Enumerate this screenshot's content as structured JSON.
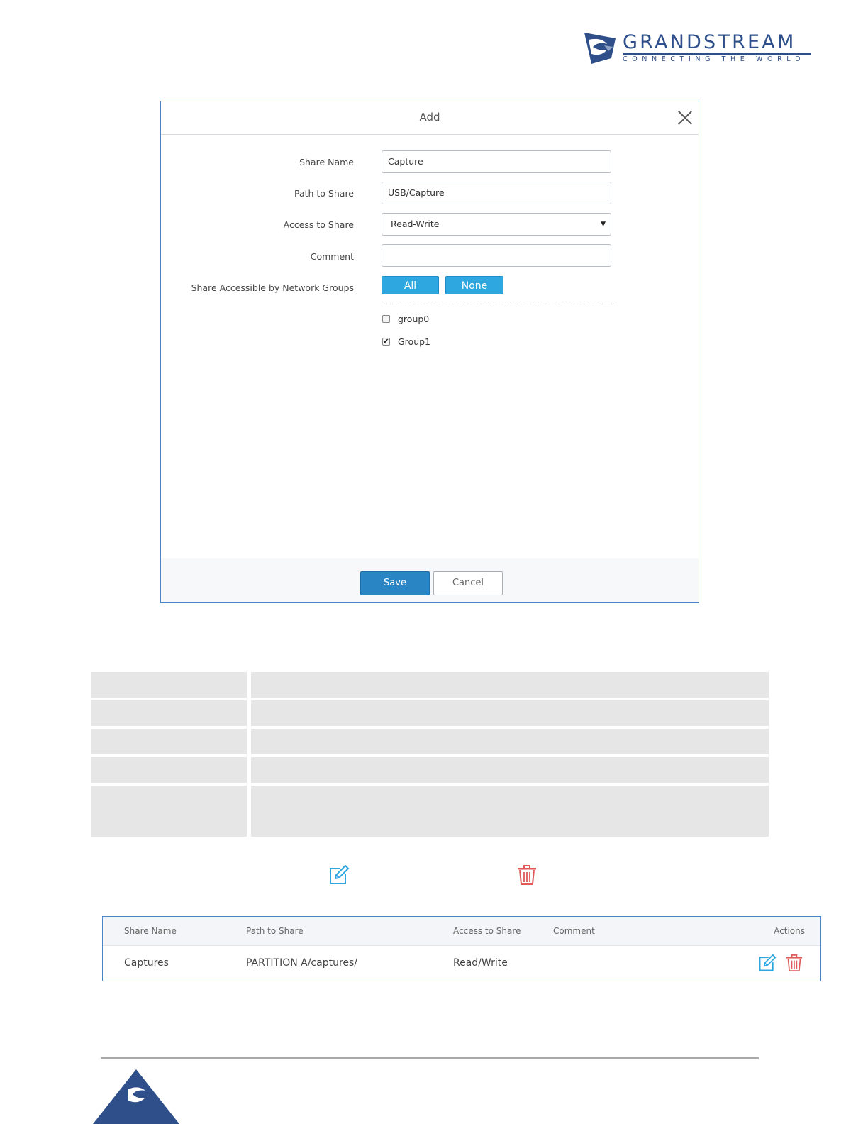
{
  "logo": {
    "brand": "GRANDSTREAM",
    "tagline": "CONNECTING THE WORLD",
    "brand_color": "#2f4f8a"
  },
  "dialog": {
    "title": "Add",
    "close_icon": "close-icon",
    "fields": {
      "share_name": {
        "label": "Share Name",
        "value": "Capture"
      },
      "path": {
        "label": "Path to Share",
        "value": "USB/Capture"
      },
      "access": {
        "label": "Access to Share",
        "value": "Read-Write"
      },
      "comment": {
        "label": "Comment",
        "value": ""
      }
    },
    "groups": {
      "label": "Share Accessible by Network Groups",
      "all_button": "All",
      "none_button": "None",
      "items": [
        {
          "label": "group0",
          "checked": false
        },
        {
          "label": "Group1",
          "checked": true
        }
      ]
    },
    "save_label": "Save",
    "cancel_label": "Cancel",
    "accent_color": "#2ea7e0"
  },
  "icons": {
    "edit": "edit-icon",
    "delete": "trash-icon",
    "edit_color": "#2ea7e0",
    "delete_color": "#e05a5a"
  },
  "share_table": {
    "headers": [
      "Share Name",
      "Path to Share",
      "Access to Share",
      "Comment",
      "Actions"
    ],
    "rows": [
      {
        "share_name": "Captures",
        "path": "PARTITION A/captures/",
        "access": "Read/Write",
        "comment": ""
      }
    ]
  }
}
